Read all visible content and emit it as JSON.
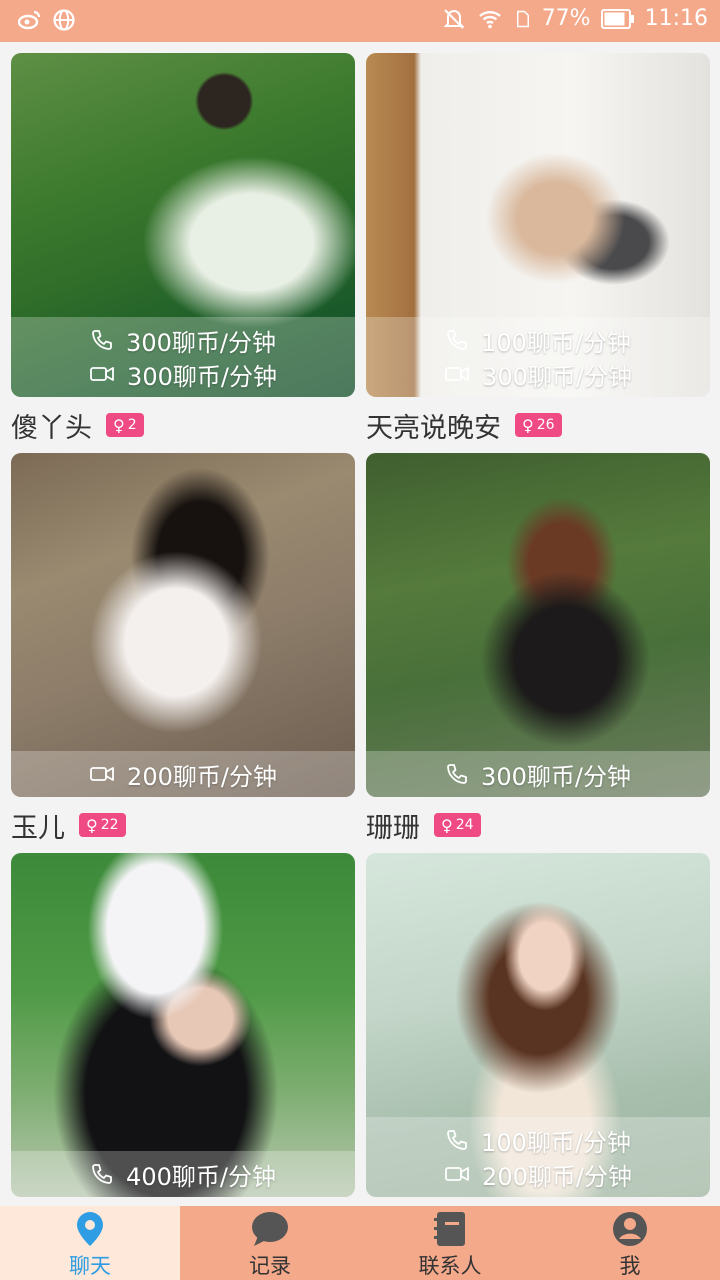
{
  "status_bar": {
    "battery": "77%",
    "time": "11:16",
    "icons": [
      "weibo-icon",
      "globe-icon",
      "mute-icon",
      "wifi-icon",
      "sim-icon",
      "battery-icon"
    ]
  },
  "cards": [
    {
      "name": "傻丫头",
      "age": "2",
      "voice_price": "300聊币/分钟",
      "video_price": "300聊币/分钟"
    },
    {
      "name": "天亮说晚安",
      "age": "26",
      "voice_price": "100聊币/分钟",
      "video_price": "300聊币/分钟"
    },
    {
      "name": "玉儿",
      "age": "22",
      "video_price": "200聊币/分钟"
    },
    {
      "name": "珊珊",
      "age": "24",
      "voice_price": "300聊币/分钟"
    },
    {
      "voice_price": "400聊币/分钟"
    },
    {
      "voice_price": "100聊币/分钟",
      "video_price": "200聊币/分钟"
    }
  ],
  "tabs": [
    {
      "label": "聊天",
      "icon": "location-pin-icon"
    },
    {
      "label": "记录",
      "icon": "chat-bubble-icon"
    },
    {
      "label": "联系人",
      "icon": "contacts-book-icon"
    },
    {
      "label": "我",
      "icon": "user-icon"
    }
  ],
  "colors": {
    "primary": "#f5a98b",
    "tab_active_bg": "#fde8da",
    "tab_active_text": "#2f9de3",
    "badge": "#f04a85"
  }
}
